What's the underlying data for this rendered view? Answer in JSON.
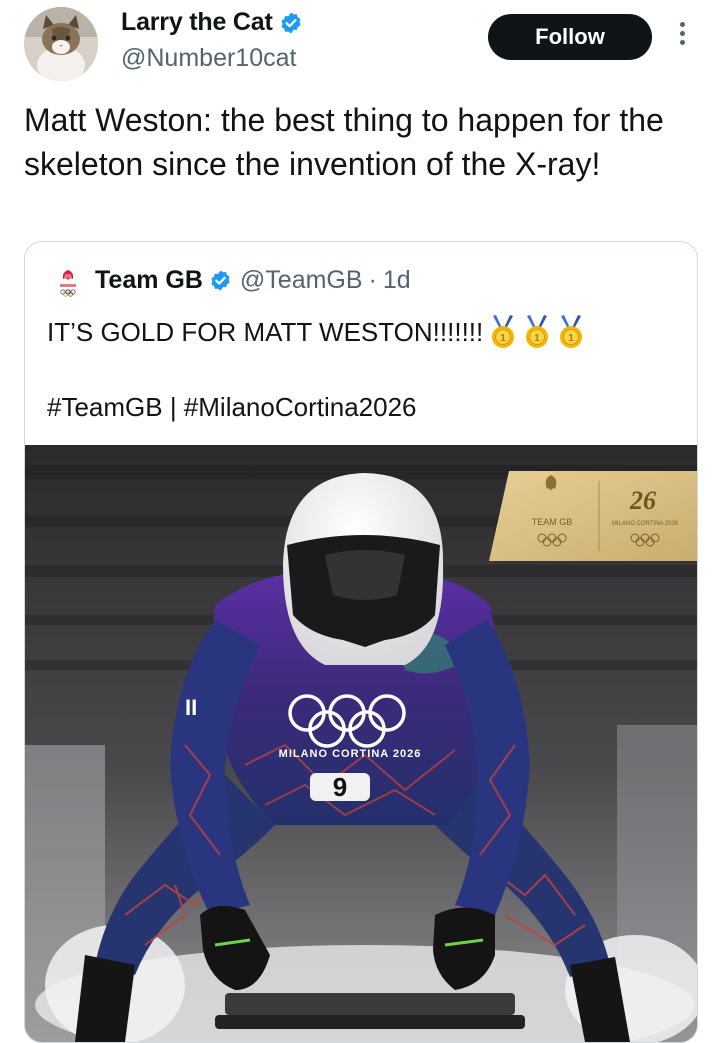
{
  "author": {
    "display_name": "Larry the Cat",
    "handle": "@Number10cat",
    "verified_icon": "verified-badge-icon",
    "avatar_icon": "cat-avatar"
  },
  "actions": {
    "follow_label": "Follow",
    "more_icon": "more-vertical-icon"
  },
  "tweet": {
    "text": "Matt Weston: the best thing to happen for the skeleton since the invention of the X-ray!"
  },
  "quoted_tweet": {
    "display_name": "Team GB",
    "handle": "@TeamGB",
    "separator": "·",
    "time": "1d",
    "line1": "IT’S GOLD FOR MATT WESTON!!!!!!!",
    "line2": "#TeamGB | #MilanoCortina2026",
    "medals": [
      "gold-medal-icon",
      "gold-medal-icon",
      "gold-medal-icon"
    ],
    "image": {
      "bib_number": "9",
      "suit_text": "MILANO CORTINA 2026",
      "sign_left": "TEAM GB",
      "sign_right": "MILANO CORTINA 2026",
      "sign_mark": "26"
    }
  },
  "colors": {
    "text": "#0f1419",
    "secondary": "#536471",
    "verified_blue": "#1d9bf0",
    "border": "#cfd9de",
    "button_bg": "#0f1419",
    "medal_gold": "#f2b705",
    "suit_purple": "#4b2a8a",
    "sign_gold": "#d8bf83"
  }
}
